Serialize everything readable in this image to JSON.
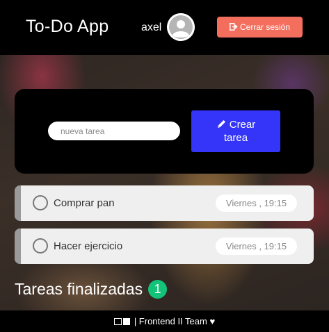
{
  "header": {
    "title": "To-Do App",
    "username": "axel",
    "logout_label": "Cerrar sesión"
  },
  "new_task": {
    "placeholder": "nueva tarea",
    "create_label_line1": "Crear",
    "create_label_line2": "tarea"
  },
  "pending_tasks": [
    {
      "name": "Comprar pan",
      "time": "Viernes , 19:15"
    },
    {
      "name": "Hacer ejercicio",
      "time": "Viernes , 19:15"
    }
  ],
  "finished": {
    "title": "Tareas finalizadas",
    "count": "1"
  },
  "footer": {
    "text": "| Frontend II Team ♥"
  },
  "colors": {
    "logout": "#f46e5e",
    "create": "#3435f8",
    "badge": "#14c37a"
  }
}
